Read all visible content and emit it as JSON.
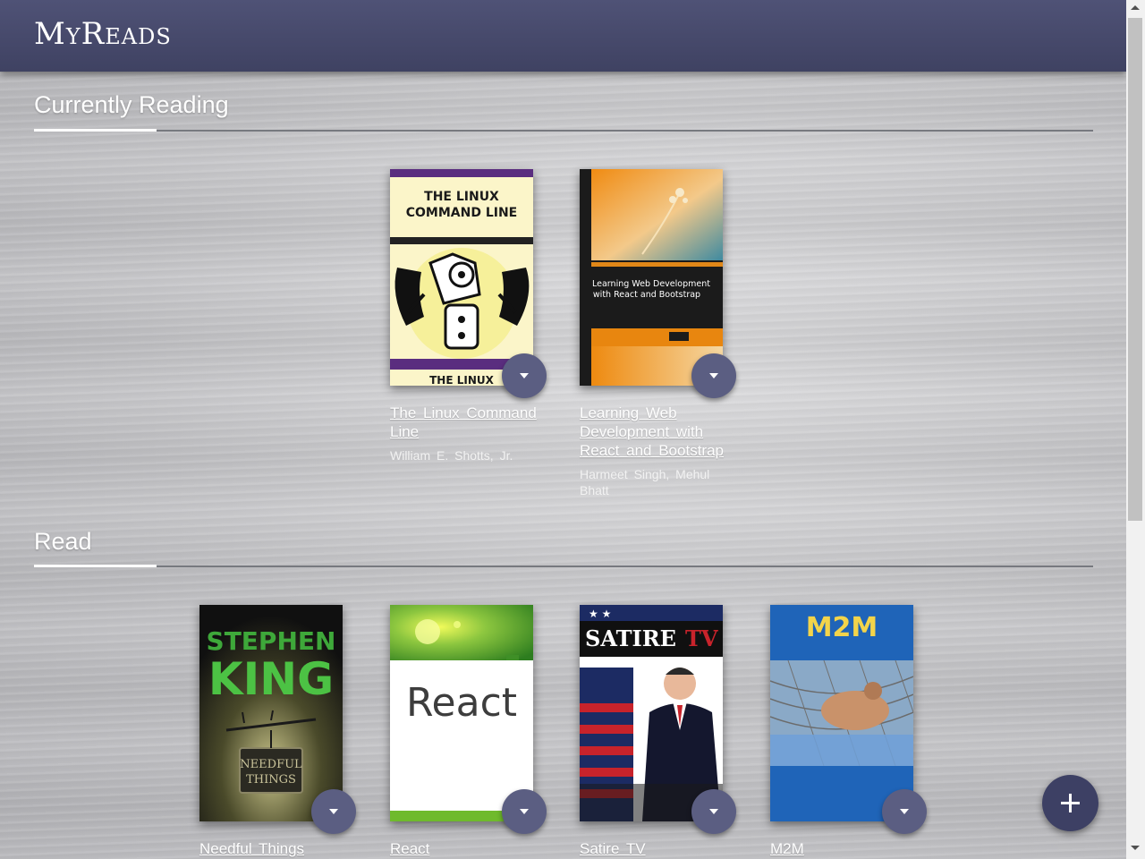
{
  "app": {
    "title": "MyReads"
  },
  "shelves": [
    {
      "title": "Currently Reading",
      "books": [
        {
          "title": "The Linux Command Line",
          "authors": "William E. Shotts, Jr."
        },
        {
          "title": "Learning Web Development with React and Bootstrap",
          "authors": "Harmeet Singh, Mehul Bhatt"
        }
      ]
    },
    {
      "title": "Read",
      "books": [
        {
          "title": "Needful Things"
        },
        {
          "title": "React"
        },
        {
          "title": "Satire TV"
        },
        {
          "title": "M2M"
        }
      ]
    }
  ],
  "icons": {
    "shelf_changer": "caret-down-icon",
    "add": "plus-icon"
  },
  "colors": {
    "header": "#4a4d70",
    "button": "#5b5e82",
    "add_button": "#3d4064"
  }
}
